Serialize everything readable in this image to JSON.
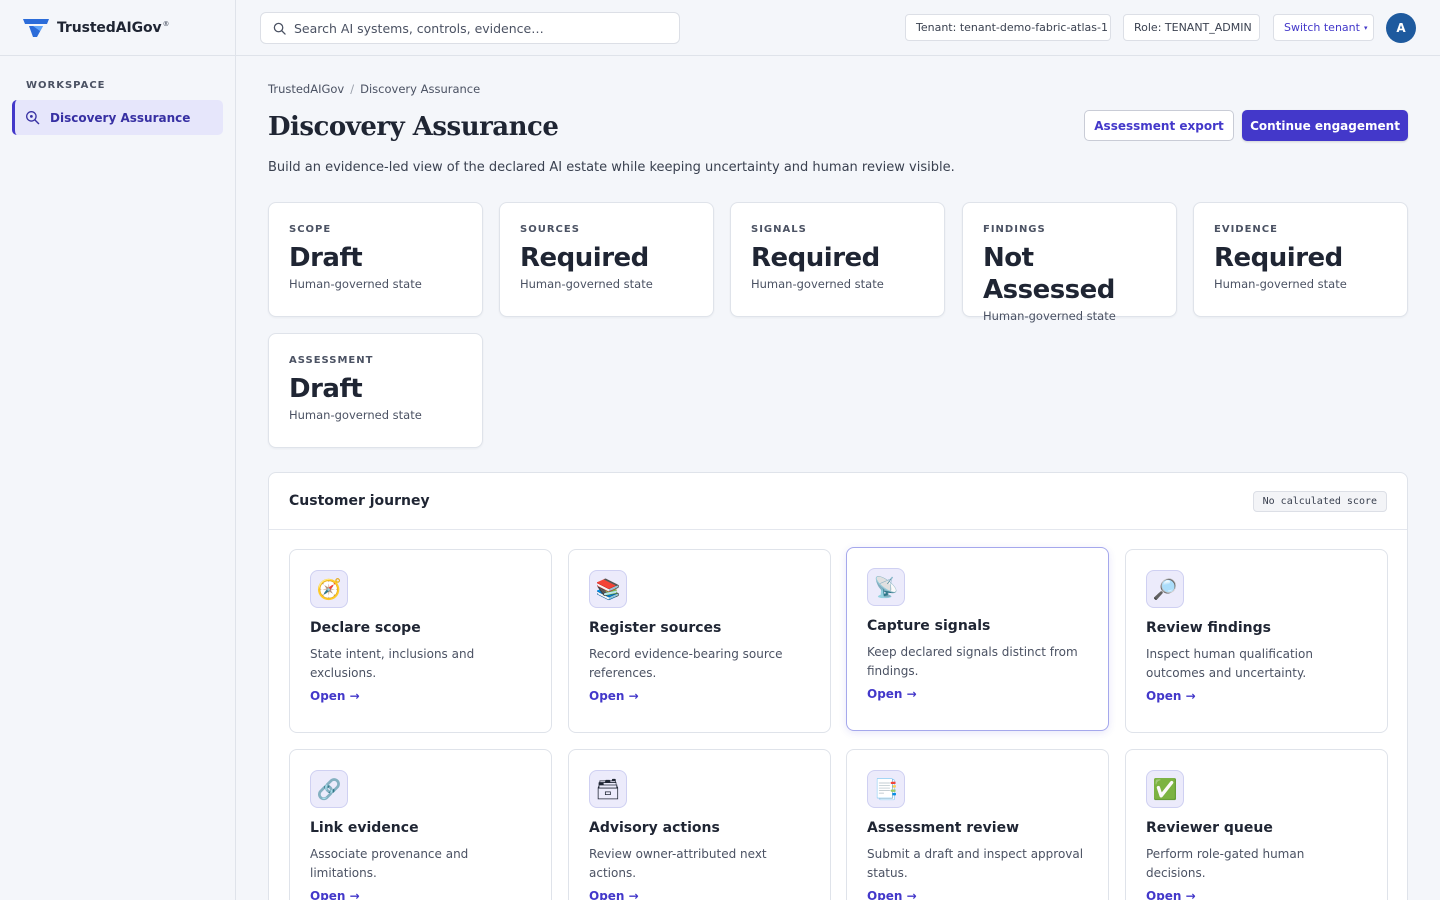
{
  "app": {
    "name": "TrustedAIGov",
    "reg_mark": "®"
  },
  "search": {
    "placeholder": "Search AI systems, controls, evidence…"
  },
  "header": {
    "tenant": "Tenant: tenant-demo-fabric-atlas-1",
    "role": "Role: TENANT_ADMIN",
    "switch_tenant": "Switch tenant",
    "switch_caret": "▾",
    "avatar_initial": "A"
  },
  "sidebar": {
    "heading": "WORKSPACE",
    "items": [
      {
        "label": "Discovery Assurance",
        "icon": "search-check-icon",
        "active": true
      }
    ]
  },
  "breadcrumb": {
    "items": [
      "TrustedAIGov",
      "Discovery Assurance"
    ],
    "separator": "/"
  },
  "page": {
    "title": "Discovery Assurance",
    "subtitle": "Build an evidence-led view of the declared AI estate while keeping uncertainty and human review visible.",
    "export_label": "Assessment export",
    "continue_label": "Continue engagement"
  },
  "stats": [
    {
      "label": "SCOPE",
      "value": "Draft",
      "caption": "Human-governed state"
    },
    {
      "label": "SOURCES",
      "value": "Required",
      "caption": "Human-governed state"
    },
    {
      "label": "SIGNALS",
      "value": "Required",
      "caption": "Human-governed state"
    },
    {
      "label": "FINDINGS",
      "value": "Not Assessed",
      "caption": "Human-governed state"
    },
    {
      "label": "EVIDENCE",
      "value": "Required",
      "caption": "Human-governed state"
    },
    {
      "label": "ASSESSMENT",
      "value": "Draft",
      "caption": "Human-governed state"
    }
  ],
  "journey": {
    "title": "Customer journey",
    "badge": "No calculated score",
    "steps": [
      {
        "title": "Declare scope",
        "desc": "State intent, inclusions and exclusions.",
        "open": "Open →",
        "icon": "compass-icon",
        "glyph": "🧭"
      },
      {
        "title": "Register sources",
        "desc": "Record evidence-bearing source references.",
        "open": "Open →",
        "icon": "books-icon",
        "glyph": "📚"
      },
      {
        "title": "Capture signals",
        "desc": "Keep declared signals distinct from findings.",
        "open": "Open →",
        "icon": "satellite-dish-icon",
        "glyph": "📡",
        "active": true
      },
      {
        "title": "Review findings",
        "desc": "Inspect human qualification outcomes and uncertainty.",
        "open": "Open →",
        "icon": "magnifier-icon",
        "glyph": "🔎"
      },
      {
        "title": "Link evidence",
        "desc": "Associate provenance and limitations.",
        "open": "Open →",
        "icon": "link-icon",
        "glyph": "🔗"
      },
      {
        "title": "Advisory actions",
        "desc": "Review owner-attributed next actions.",
        "open": "Open →",
        "icon": "card-box-icon",
        "glyph": "🗃"
      },
      {
        "title": "Assessment review",
        "desc": "Submit a draft and inspect approval status.",
        "open": "Open →",
        "icon": "document-flag-icon",
        "glyph": "📑"
      },
      {
        "title": "Reviewer queue",
        "desc": "Perform role-gated human decisions.",
        "open": "Open →",
        "icon": "check-mark-icon",
        "glyph": "✅"
      }
    ]
  }
}
